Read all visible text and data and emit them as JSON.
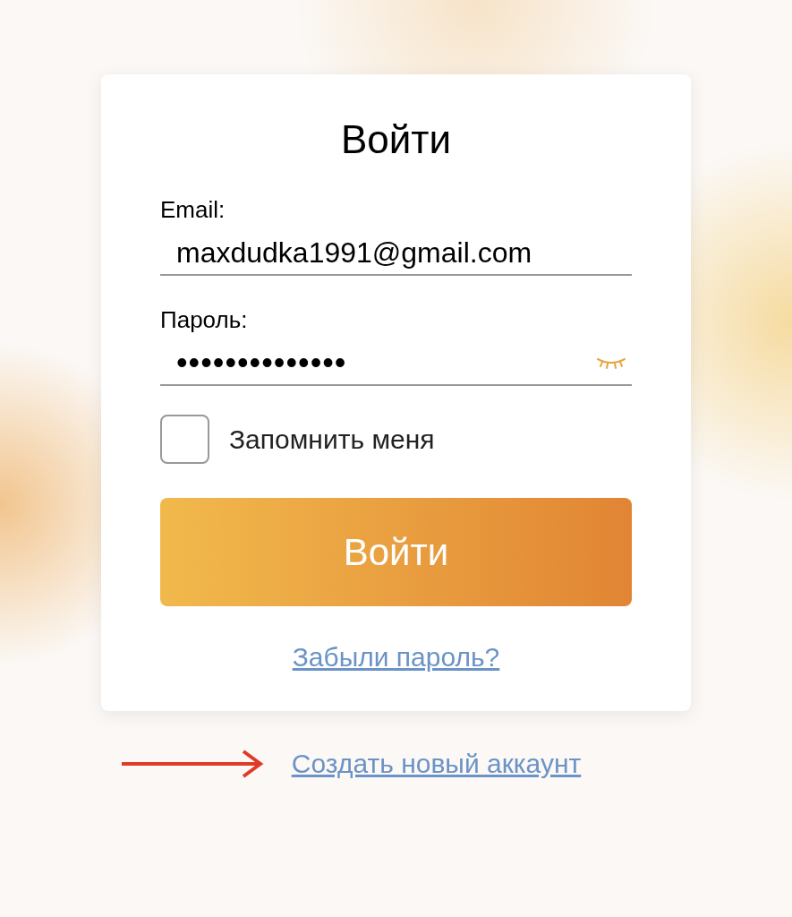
{
  "card": {
    "title": "Войти",
    "fields": [
      {
        "kind": "text",
        "label": "Email:",
        "value": "maxdudka1991@gmail.com"
      },
      {
        "kind": "password",
        "label": "Пароль:",
        "value": "••••••••••••••",
        "revealed": false
      }
    ],
    "remember": {
      "label": "Запомнить меня",
      "checked": false
    },
    "submit": "Войти",
    "forgot": "Забыли пароль?"
  },
  "create_account": "Создать новый аккаунт"
}
